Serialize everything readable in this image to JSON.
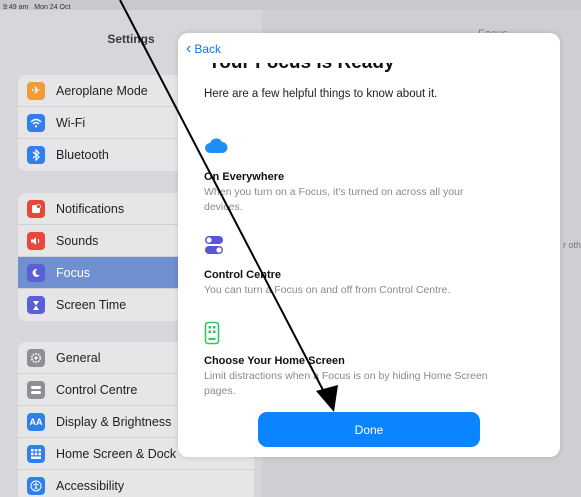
{
  "status_bar": {
    "time": "9:49 am",
    "date": "Mon 24 Oct"
  },
  "sidebar": {
    "title": "Settings",
    "groups": [
      {
        "items": [
          {
            "label": "Aeroplane Mode",
            "icon": "airplane-icon",
            "color": "#f39c36"
          },
          {
            "label": "Wi-Fi",
            "icon": "wifi-icon",
            "color": "#2f80ed"
          },
          {
            "label": "Bluetooth",
            "icon": "bluetooth-icon",
            "color": "#2f80ed"
          }
        ]
      },
      {
        "items": [
          {
            "label": "Notifications",
            "icon": "bell-icon",
            "color": "#e9473c"
          },
          {
            "label": "Sounds",
            "icon": "speaker-icon",
            "color": "#e9473c"
          },
          {
            "label": "Focus",
            "icon": "moon-icon",
            "color": "#5b5fd6",
            "selected": true
          },
          {
            "label": "Screen Time",
            "icon": "hourglass-icon",
            "color": "#5b5fd6"
          }
        ]
      },
      {
        "items": [
          {
            "label": "General",
            "icon": "gear-icon",
            "color": "#8e8e93"
          },
          {
            "label": "Control Centre",
            "icon": "switches-icon",
            "color": "#8e8e93"
          },
          {
            "label": "Display & Brightness",
            "icon": "aa-icon",
            "color": "#2f80ed"
          },
          {
            "label": "Home Screen & Dock",
            "icon": "grid-icon",
            "color": "#2f80ed"
          },
          {
            "label": "Accessibility",
            "icon": "accessibility-icon",
            "color": "#2f80ed"
          }
        ]
      }
    ]
  },
  "detail": {
    "title": "Focus",
    "fragment": "r oth"
  },
  "modal": {
    "back_label": "Back",
    "heading": "Your Focus Is Ready",
    "intro": "Here are a few helpful things to know about it.",
    "features": [
      {
        "icon": "cloud-icon",
        "title": "On Everywhere",
        "desc": "When you turn on a Focus, it's turned on across all your devices."
      },
      {
        "icon": "toggle-icon",
        "title": "Control Centre",
        "desc": "You can turn a Focus on and off from Control Centre."
      },
      {
        "icon": "phone-icon",
        "title": "Choose Your Home Screen",
        "desc": "Limit distractions when a Focus is on by hiding Home Screen pages."
      }
    ],
    "done_label": "Done"
  },
  "colors": {
    "accent": "#0a84ff",
    "selection": "#6f8fd0"
  }
}
